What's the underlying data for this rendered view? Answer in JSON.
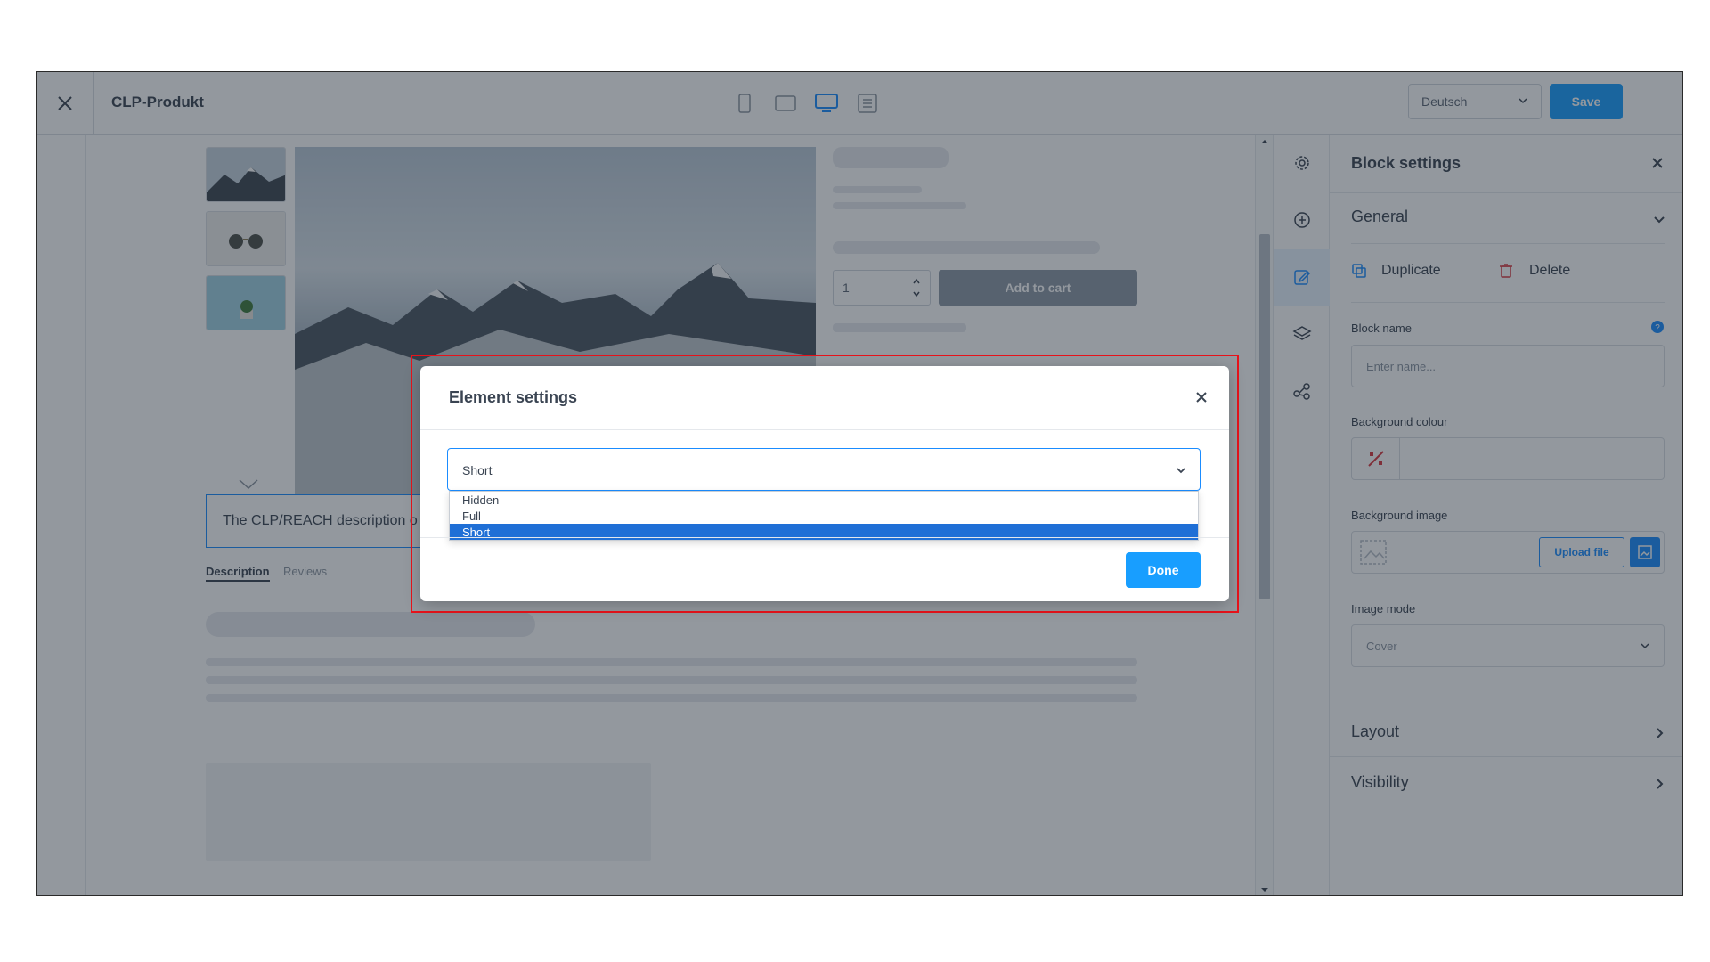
{
  "header": {
    "title": "CLP-Produkt",
    "language": "Deutsch",
    "save_label": "Save",
    "view_icons": [
      "mobile-icon",
      "tablet-icon",
      "desktop-icon",
      "list-view-icon"
    ]
  },
  "canvas": {
    "quantity": "1",
    "add_to_cart_label": "Add to cart",
    "description_text": "The CLP/REACH description o",
    "tabs": [
      "Description",
      "Reviews"
    ]
  },
  "rail": {
    "icons": [
      "settings-icon",
      "add-icon",
      "edit-icon",
      "layers-icon",
      "share-icon"
    ]
  },
  "block_settings": {
    "title": "Block settings",
    "general_label": "General",
    "duplicate_label": "Duplicate",
    "delete_label": "Delete",
    "block_name_label": "Block name",
    "block_name_placeholder": "Enter name...",
    "background_colour_label": "Background colour",
    "background_image_label": "Background image",
    "upload_file_label": "Upload file",
    "image_mode_label": "Image mode",
    "image_mode_value": "Cover",
    "layout_label": "Layout",
    "visibility_label": "Visibility"
  },
  "modal": {
    "title": "Element settings",
    "selected_value": "Short",
    "options": [
      "Hidden",
      "Full",
      "Short"
    ],
    "selected_option_index": 2,
    "done_label": "Done"
  },
  "colors": {
    "accent": "#189eff",
    "highlight_border": "#e8131b",
    "selected_option": "#1f6fd6"
  }
}
